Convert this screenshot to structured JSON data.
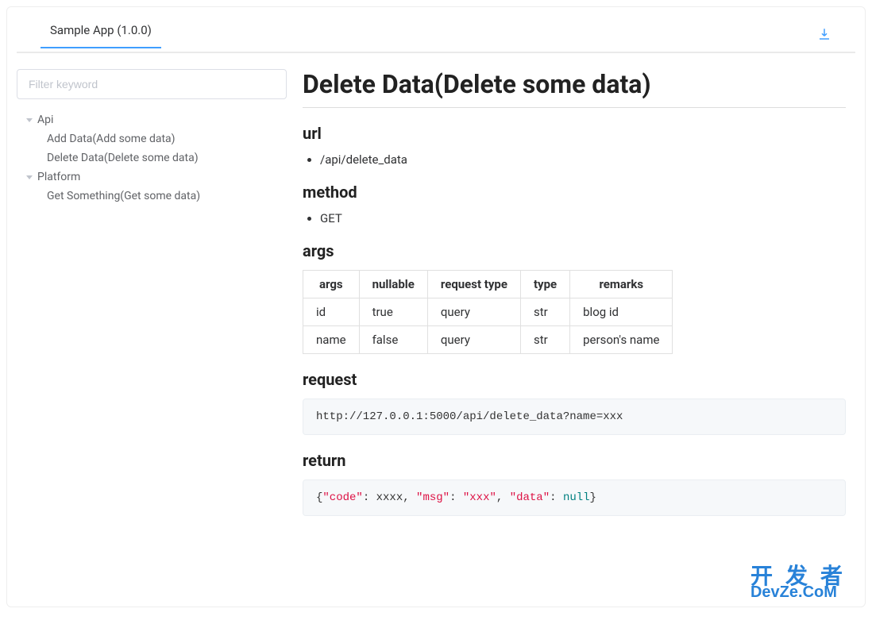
{
  "header": {
    "tab_label": "Sample App (1.0.0)"
  },
  "sidebar": {
    "filter_placeholder": "Filter keyword",
    "groups": [
      {
        "label": "Api",
        "items": [
          "Add Data(Add some data)",
          "Delete Data(Delete some data)"
        ]
      },
      {
        "label": "Platform",
        "items": [
          "Get Something(Get some data)"
        ]
      }
    ]
  },
  "main": {
    "title": "Delete Data(Delete some data)",
    "sections": {
      "url": {
        "heading": "url",
        "value": "/api/delete_data"
      },
      "method": {
        "heading": "method",
        "value": "GET"
      },
      "args": {
        "heading": "args",
        "columns": [
          "args",
          "nullable",
          "request type",
          "type",
          "remarks"
        ],
        "rows": [
          [
            "id",
            "true",
            "query",
            "str",
            "blog id"
          ],
          [
            "name",
            "false",
            "query",
            "str",
            "person's name"
          ]
        ]
      },
      "request": {
        "heading": "request",
        "code": "http://127.0.0.1:5000/api/delete_data?name=xxx"
      },
      "return": {
        "heading": "return",
        "raw": "{\"code\": xxxx, \"msg\": \"xxx\", \"data\": null}",
        "tokens": [
          {
            "t": "{"
          },
          {
            "t": "\"code\"",
            "c": "str"
          },
          {
            "t": ": xxxx, "
          },
          {
            "t": "\"msg\"",
            "c": "str"
          },
          {
            "t": ": "
          },
          {
            "t": "\"xxx\"",
            "c": "str"
          },
          {
            "t": ", "
          },
          {
            "t": "\"data\"",
            "c": "str"
          },
          {
            "t": ": "
          },
          {
            "t": "null",
            "c": "null"
          },
          {
            "t": "}"
          }
        ]
      }
    }
  },
  "watermark": {
    "top": "开发者",
    "bottom": "DevZe.CoM"
  }
}
